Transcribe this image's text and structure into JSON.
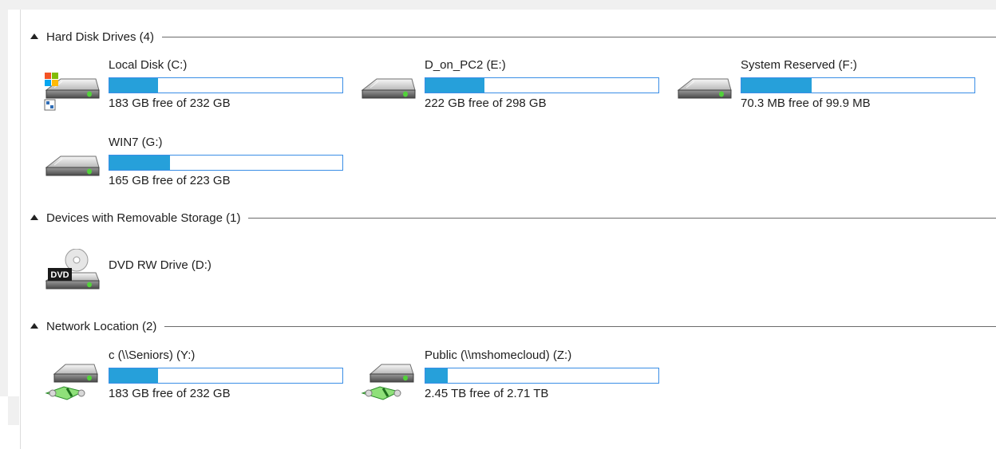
{
  "colors": {
    "bar_fill": "#26a0da",
    "bar_border": "#3a8ee6",
    "group_line": "#6b6b6b"
  },
  "groups": [
    {
      "header": "Hard Disk Drives (4)",
      "items": [
        {
          "name": "Local Disk (C:)",
          "free_text": "183 GB free of 232 GB",
          "used_fraction": 0.21,
          "icon": "windows-system-drive-icon"
        },
        {
          "name": "D_on_PC2 (E:)",
          "free_text": "222 GB free of 298 GB",
          "used_fraction": 0.255,
          "icon": "hard-drive-icon"
        },
        {
          "name": "System Reserved (F:)",
          "free_text": "70.3 MB free of 99.9 MB",
          "used_fraction": 0.3,
          "icon": "hard-drive-icon"
        },
        {
          "name": "WIN7 (G:)",
          "free_text": "165 GB free of 223 GB",
          "used_fraction": 0.26,
          "icon": "hard-drive-icon"
        }
      ]
    },
    {
      "header": "Devices with Removable Storage (1)",
      "items": [
        {
          "name": "DVD RW Drive (D:)",
          "icon": "dvd-drive-icon",
          "badge": "DVD"
        }
      ]
    },
    {
      "header": "Network Location (2)",
      "items": [
        {
          "name": "c (\\\\Seniors) (Y:)",
          "free_text": "183 GB free of 232 GB",
          "used_fraction": 0.21,
          "icon": "network-drive-icon"
        },
        {
          "name": "Public (\\\\mshomecloud) (Z:)",
          "free_text": "2.45 TB free of 2.71 TB",
          "used_fraction": 0.096,
          "icon": "network-drive-icon"
        }
      ]
    }
  ]
}
